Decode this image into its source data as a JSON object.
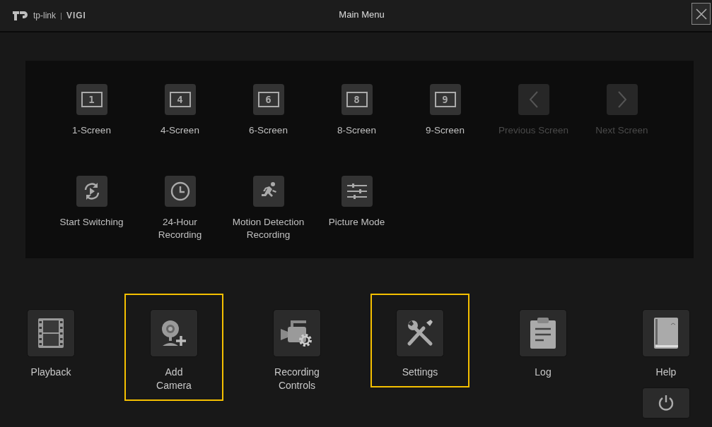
{
  "window": {
    "title": "Main Menu"
  },
  "logo": {
    "brand": "tp-link",
    "separator": "|",
    "product": "VIGI"
  },
  "quick_panel": {
    "items": [
      {
        "kind": "screen",
        "digit": "1",
        "label": "1-Screen",
        "disabled": false
      },
      {
        "kind": "screen",
        "digit": "4",
        "label": "4-Screen",
        "disabled": false
      },
      {
        "kind": "screen",
        "digit": "6",
        "label": "6-Screen",
        "disabled": false
      },
      {
        "kind": "screen",
        "digit": "8",
        "label": "8-Screen",
        "disabled": false
      },
      {
        "kind": "screen",
        "digit": "9",
        "label": "9-Screen",
        "disabled": false
      },
      {
        "kind": "previous",
        "label": "Previous Screen",
        "disabled": true
      },
      {
        "kind": "next",
        "label": "Next Screen",
        "disabled": true
      },
      {
        "kind": "switching",
        "label": "Start Switching",
        "disabled": false
      },
      {
        "kind": "clock",
        "label": "24-Hour\nRecording",
        "disabled": false
      },
      {
        "kind": "motion",
        "label": "Motion Detection\nRecording",
        "disabled": false
      },
      {
        "kind": "picture",
        "label": "Picture Mode",
        "disabled": false
      }
    ]
  },
  "menu": {
    "items": [
      {
        "kind": "playback",
        "label": "Playback",
        "highlighted": false
      },
      {
        "kind": "camera",
        "label": "Add\nCamera",
        "highlighted": true
      },
      {
        "kind": "recording",
        "label": "Recording\nControls",
        "highlighted": false
      },
      {
        "kind": "settings",
        "label": "Settings",
        "highlighted": true
      },
      {
        "kind": "log",
        "label": "Log",
        "highlighted": false
      },
      {
        "kind": "help",
        "label": "Help",
        "highlighted": false
      }
    ]
  }
}
